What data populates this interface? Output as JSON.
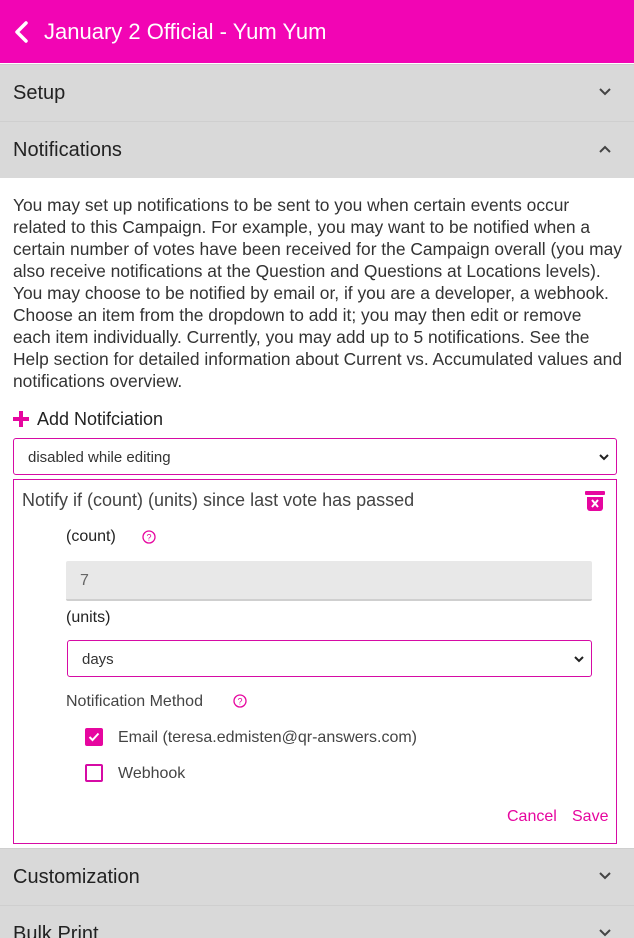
{
  "header": {
    "title": "January 2 Official - Yum Yum"
  },
  "sections": {
    "setup": "Setup",
    "notifications": "Notifications",
    "customization": "Customization",
    "bulk_print": "Bulk Print"
  },
  "notifications": {
    "description": "You may set up notifications to be sent to you when certain events occur related to this Campaign.  For example, you may want to be notified when a certain number of votes have been received for the Campaign overall (you may also receive notifications at the Question and Questions at Locations levels).  You may choose to be notified by email or, if you are a developer, a webhook.  Choose an item from the dropdown to add it; you may then edit or remove each item individually. Currently, you may add up to 5 notifications. See the Help section for detailed information about Current vs. Accumulated values and notifications overview.",
    "add_label": "Add Notifciation",
    "add_select_value": "disabled while editing",
    "card": {
      "title": "Notify if (count) (units) since last vote has passed",
      "count_label": "(count)",
      "count_value": "7",
      "units_label": "(units)",
      "units_value": "days",
      "method_label": "Notification Method",
      "email_label": "Email (teresa.edmisten@qr-answers.com)",
      "email_checked": true,
      "webhook_label": "Webhook",
      "webhook_checked": false,
      "cancel_label": "Cancel",
      "save_label": "Save"
    }
  },
  "colors": {
    "accent": "#f205b4",
    "accent_dark": "#e6069f",
    "section_bg": "#d9d9d9"
  },
  "icons": [
    "back-arrow-icon",
    "chevron-down-icon",
    "chevron-up-icon",
    "plus-icon",
    "trash-icon",
    "help-icon",
    "checkmark-icon",
    "select-arrow-icon"
  ]
}
